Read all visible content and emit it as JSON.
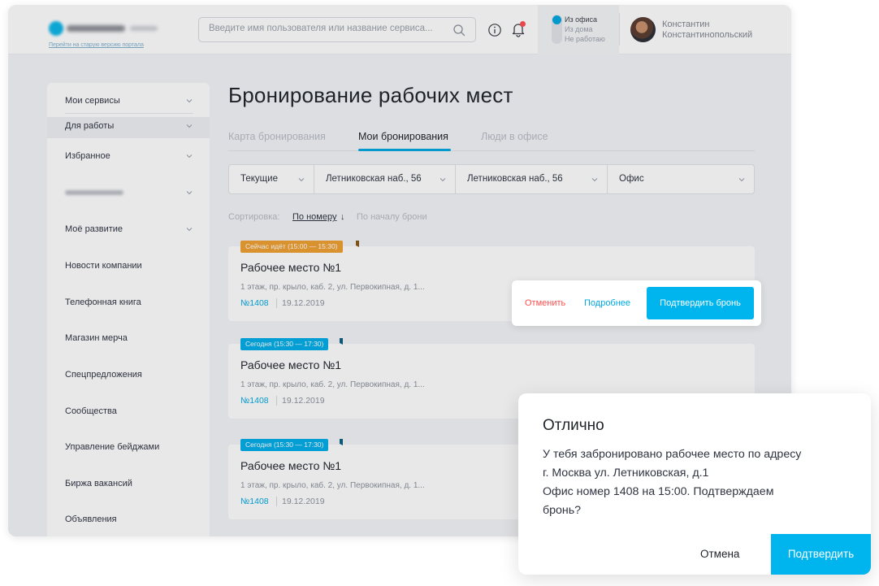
{
  "header": {
    "old_portal_link": "Перейти на старую версию портала",
    "search_placeholder": "Введите имя пользователя или название сервиса...",
    "status_options": [
      "Из офиса",
      "Из дома",
      "Не работаю"
    ],
    "user_first_name": "Константин",
    "user_last_name": "Константинопольский",
    "icons": {
      "search": "search-icon",
      "info": "info-icon",
      "notifications": "bell-icon"
    }
  },
  "sidebar": {
    "items": [
      {
        "label": "Мои сервисы",
        "has_chevron": true
      },
      {
        "label": "Для работы",
        "has_chevron": true
      },
      {
        "label": "Избранное",
        "has_chevron": true
      },
      {
        "label": "",
        "has_chevron": true,
        "blurred": true
      },
      {
        "label": "Моё развитие",
        "has_chevron": true
      },
      {
        "label": "Новости компании"
      },
      {
        "label": "Телефонная книга"
      },
      {
        "label": "Магазин мерча"
      },
      {
        "label": "Спецпредложения"
      },
      {
        "label": "Сообщества"
      },
      {
        "label": "Управление бейджами"
      },
      {
        "label": "Биржа вакансий"
      },
      {
        "label": "Объявления"
      }
    ]
  },
  "main": {
    "title": "Бронирование рабочих мест",
    "tabs": [
      {
        "label": "Карта бронирования"
      },
      {
        "label": "Мои бронирования",
        "active": true
      },
      {
        "label": "Люди в офисе"
      }
    ],
    "filters": [
      "Текущие",
      "Летниковская наб., 56",
      "Летниковская наб., 56",
      "Офис"
    ],
    "sort": {
      "label": "Сортировка:",
      "by_number": "По номеру",
      "arrow": "↓",
      "by_start": "По началу брони"
    },
    "bookings": [
      {
        "badge": "Сейчас идёт (15:00 — 15:30)",
        "badge_color": "#f0a030",
        "title": "Рабочее место №1",
        "address": "1 этаж, пр. крыло, каб. 2, ул. Первокипная, д. 1...",
        "number": "№1408",
        "date": "19.12.2019"
      },
      {
        "badge": "Сегодня (15:30 — 17:30)",
        "badge_color": "#00aee8",
        "title": "Рабочее место №1",
        "address": "1 этаж, пр. крыло, каб. 2, ул. Первокипная, д. 1...",
        "number": "№1408",
        "date": "19.12.2019"
      },
      {
        "badge": "Сегодня (15:30 — 17:30)",
        "badge_color": "#00aee8",
        "title": "Рабочее место №1",
        "address": "1 этаж, пр. крыло, каб. 2, ул. Первокипная, д. 1...",
        "number": "№1408",
        "date": "19.12.2019"
      }
    ]
  },
  "booking_actions": {
    "cancel": "Отменить",
    "details": "Подробнее",
    "confirm": "Подтвердить бронь"
  },
  "dialog": {
    "title": "Отлично",
    "body": [
      "У тебя забронировано рабочее место по адресу",
      "г. Москва ул. Летниковская, д.1",
      "Офис номер 1408 на 15:00. Подтверждаем",
      "бронь?"
    ],
    "cancel": "Отмена",
    "confirm": "Подтвердить"
  },
  "colors": {
    "accent": "#00b4ee",
    "danger": "#ff4d4f",
    "badge_current": "#f0a030",
    "badge_today": "#00aee8"
  }
}
